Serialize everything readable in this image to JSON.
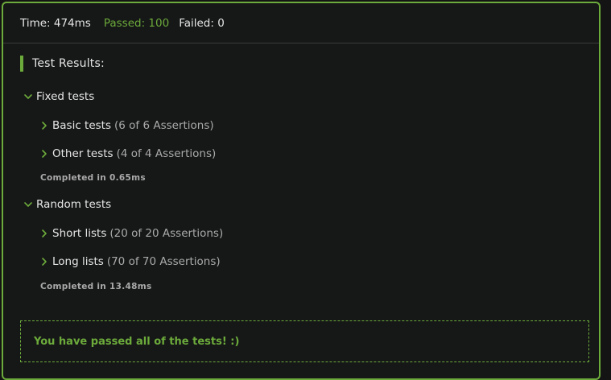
{
  "summary": {
    "time": "Time: 474ms",
    "passed": "Passed: 100",
    "failed": "Failed: 0"
  },
  "results_title": "Test Results:",
  "groups": [
    {
      "label": "Fixed tests",
      "items": [
        {
          "label": "Basic tests",
          "count": "(6 of 6 Assertions)"
        },
        {
          "label": "Other tests",
          "count": "(4 of 4 Assertions)"
        }
      ],
      "completed": "Completed in 0.65ms"
    },
    {
      "label": "Random tests",
      "items": [
        {
          "label": "Short lists",
          "count": "(20 of 20 Assertions)"
        },
        {
          "label": "Long lists",
          "count": "(70 of 70 Assertions)"
        }
      ],
      "completed": "Completed in 13.48ms"
    }
  ],
  "pass_message": "You have passed all of the tests! :)",
  "colors": {
    "accent": "#6cab3b",
    "background": "#161717",
    "muted": "#a9aaa9"
  },
  "icons": {
    "expanded": "chevron-down-icon",
    "collapsed": "chevron-right-icon"
  }
}
